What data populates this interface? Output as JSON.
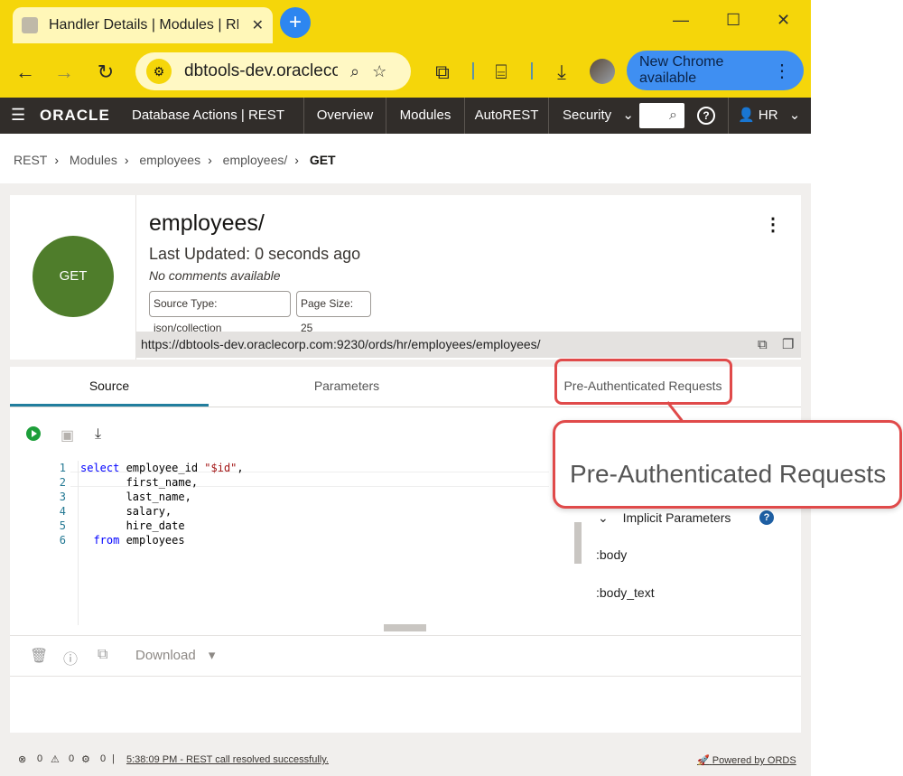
{
  "browser": {
    "tab_title": "Handler Details | Modules | REST",
    "tab_close": "✕",
    "new_tab": "+",
    "url": "dbtools-dev.oraclecorp.com",
    "new_chrome": "New Chrome available",
    "window_controls": [
      "—",
      "☐",
      "✕"
    ]
  },
  "appbar": {
    "logo": "ORACLE",
    "app_title": "Database Actions |  REST",
    "nav": [
      "Overview",
      "Modules",
      "AutoREST",
      "Security"
    ],
    "user": "HR"
  },
  "breadcrumb": [
    "REST",
    "Modules",
    "employees",
    "employees/",
    "GET"
  ],
  "handler": {
    "method": "GET",
    "title": "employees/",
    "last_updated": "Last Updated: 0 seconds ago",
    "comments": "No comments available",
    "source_type": "Source Type: json/collection",
    "page_size": "Page Size: 25",
    "url": "https://dbtools-dev.oraclecorp.com:9230/ords/hr/employees/employees/"
  },
  "tabs": [
    "Source",
    "Parameters",
    "Pre-Authenticated Requests"
  ],
  "editor": {
    "line_numbers": [
      "1",
      "2",
      "3",
      "4",
      "5",
      "6"
    ],
    "lines": [
      {
        "kw": "select",
        "text": " employee_id ",
        "str": "\"$id\"",
        "tail": ","
      },
      {
        "kw": "",
        "text": "       first_name,",
        "str": "",
        "tail": ""
      },
      {
        "kw": "",
        "text": "       last_name,",
        "str": "",
        "tail": ""
      },
      {
        "kw": "",
        "text": "       salary,",
        "str": "",
        "tail": ""
      },
      {
        "kw": "",
        "text": "       hire_date",
        "str": "",
        "tail": ""
      },
      {
        "kw": "  from",
        "text": " employees",
        "str": "",
        "tail": ""
      }
    ]
  },
  "params_panel": {
    "heading": "Implicit Parameters",
    "items": [
      ":body",
      ":body_text"
    ]
  },
  "bottom": {
    "download": "Download"
  },
  "status": {
    "errors": "0",
    "warnings": "0",
    "settings": "0",
    "message": "5:38:09 PM - REST call resolved successfully.",
    "powered": "Powered by ORDS"
  },
  "callout": {
    "text": "Pre-Authenticated Requests"
  },
  "colors": {
    "chrome_yellow": "#f5d60a",
    "oracle_bar": "#312d2a",
    "get_green": "#4f7d2b",
    "highlight_red": "#e04a4a",
    "active_tab": "#227e9e"
  }
}
